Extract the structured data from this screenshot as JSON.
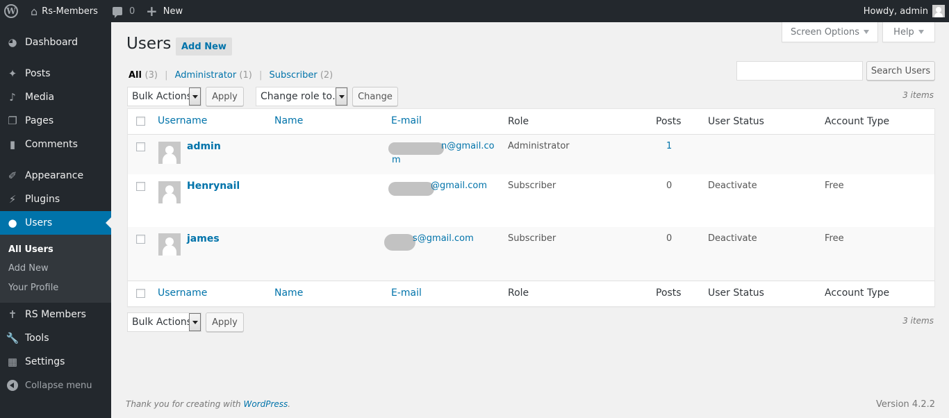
{
  "adminbar": {
    "site_name": "Rs-Members",
    "comments_count": "0",
    "new_label": "New",
    "howdy": "Howdy, admin"
  },
  "sidebar": {
    "items": [
      {
        "label": "Dashboard",
        "icon": "dashboard-icon"
      },
      {
        "label": "Posts",
        "icon": "pin-icon"
      },
      {
        "label": "Media",
        "icon": "media-icon"
      },
      {
        "label": "Pages",
        "icon": "pages-icon"
      },
      {
        "label": "Comments",
        "icon": "comment-icon"
      },
      {
        "label": "Appearance",
        "icon": "brush-icon"
      },
      {
        "label": "Plugins",
        "icon": "plug-icon"
      },
      {
        "label": "Users",
        "icon": "user-icon",
        "current": true
      },
      {
        "label": "RS Members",
        "icon": "accessibility-icon"
      },
      {
        "label": "Tools",
        "icon": "wrench-icon"
      },
      {
        "label": "Settings",
        "icon": "sliders-icon"
      }
    ],
    "submenu": [
      "All Users",
      "Add New",
      "Your Profile"
    ],
    "collapse_label": "Collapse menu"
  },
  "screen_options": {
    "label": "Screen Options"
  },
  "help": {
    "label": "Help"
  },
  "page": {
    "title": "Users",
    "add_new": "Add New"
  },
  "filters": {
    "all": {
      "label": "All",
      "count": "(3)"
    },
    "administrator": {
      "label": "Administrator",
      "count": "(1)"
    },
    "subscriber": {
      "label": "Subscriber",
      "count": "(2)"
    },
    "separator": "|"
  },
  "search": {
    "value": "",
    "button": "Search Users"
  },
  "bulk": {
    "selected": "Bulk Actions",
    "apply": "Apply"
  },
  "change_role": {
    "selected": "Change role to…",
    "button": "Change"
  },
  "items_count": "3 items",
  "table": {
    "columns": [
      "Username",
      "Name",
      "E-mail",
      "Role",
      "Posts",
      "User Status",
      "Account Type"
    ],
    "rows": [
      {
        "username": "admin",
        "name": "",
        "email_visible": "n@gmail.co",
        "email_wrap": "m",
        "role": "Administrator",
        "posts": "1",
        "status": "",
        "account_type": ""
      },
      {
        "username": "Henrynail",
        "name": "",
        "email_visible": "@gmail.com",
        "email_wrap": "",
        "role": "Subscriber",
        "posts": "0",
        "status": "Deactivate",
        "account_type": "Free"
      },
      {
        "username": "james",
        "name": "",
        "email_visible": "s@gmail.com",
        "email_wrap": "",
        "role": "Subscriber",
        "posts": "0",
        "status": "Deactivate",
        "account_type": "Free"
      }
    ]
  },
  "footer": {
    "thanks": "Thank you for creating with ",
    "wp_link": "WordPress",
    "period": ".",
    "version": "Version 4.2.2"
  }
}
